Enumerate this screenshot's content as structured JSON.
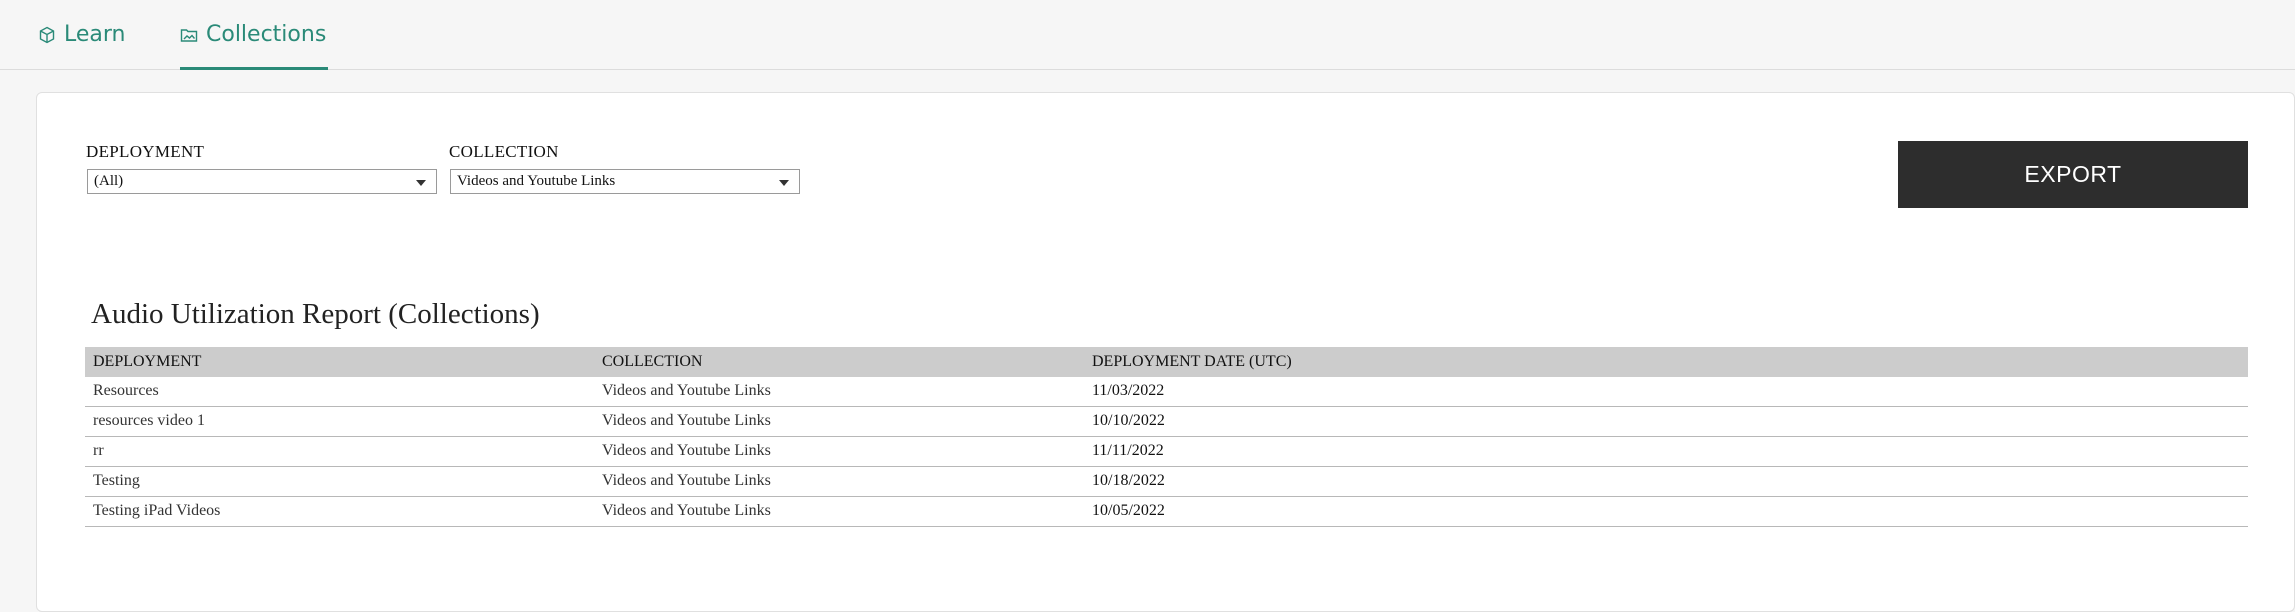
{
  "tabs": [
    {
      "label": "Learn",
      "icon": "cube-icon"
    },
    {
      "label": "Collections",
      "icon": "folder-image-icon",
      "active": true
    }
  ],
  "accent_color": "#2a8a78",
  "filters": {
    "deployment": {
      "label": "DEPLOYMENT",
      "value": "(All)"
    },
    "collection": {
      "label": "COLLECTION",
      "value": "Videos and Youtube Links"
    }
  },
  "export_label": "EXPORT",
  "report": {
    "title": "Audio Utilization Report (Collections)",
    "columns": [
      "DEPLOYMENT",
      "COLLECTION",
      "DEPLOYMENT DATE (UTC)"
    ],
    "rows": [
      {
        "deployment": "Resources",
        "collection": "Videos and Youtube Links",
        "date": "11/03/2022"
      },
      {
        "deployment": "resources video 1",
        "collection": "Videos and Youtube Links",
        "date": "10/10/2022"
      },
      {
        "deployment": "rr",
        "collection": "Videos and Youtube Links",
        "date": "11/11/2022"
      },
      {
        "deployment": "Testing",
        "collection": "Videos and Youtube Links",
        "date": "10/18/2022"
      },
      {
        "deployment": "Testing iPad Videos",
        "collection": "Videos and Youtube Links",
        "date": "10/05/2022"
      }
    ]
  }
}
